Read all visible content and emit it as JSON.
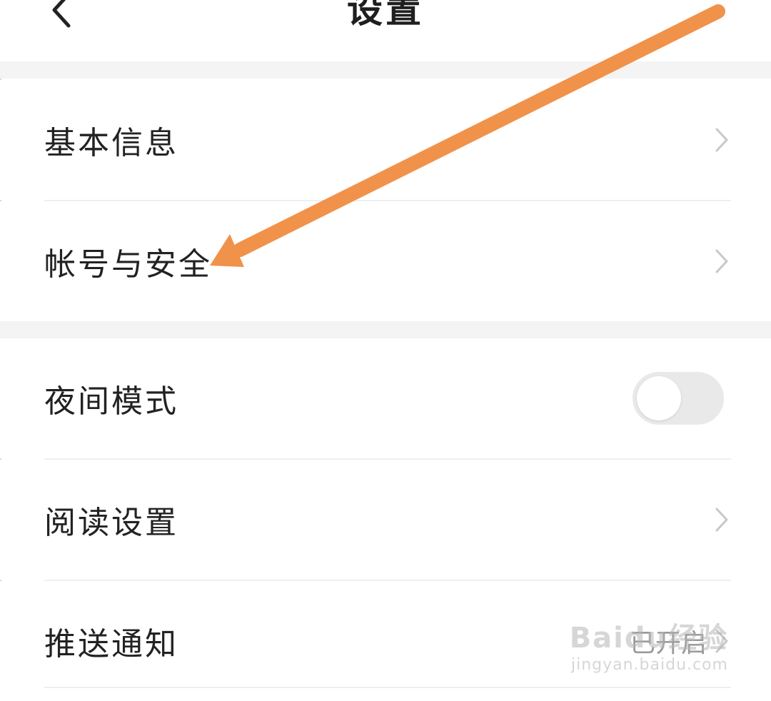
{
  "header": {
    "title": "设置",
    "back_icon": "chevron-left-icon"
  },
  "settings": {
    "basic_info": {
      "label": "基本信息",
      "icon": "chevron-right-icon"
    },
    "account_security": {
      "label": "帐号与安全",
      "icon": "chevron-right-icon"
    },
    "night_mode": {
      "label": "夜间模式",
      "enabled": false
    },
    "reading_settings": {
      "label": "阅读设置",
      "icon": "chevron-right-icon"
    },
    "push_notifications": {
      "label": "推送通知",
      "value": "已开启"
    }
  },
  "annotation": {
    "arrow_color": "#F0924A",
    "target": "account_security"
  },
  "watermark": {
    "brand": "Baidu经验",
    "url": "jingyan.baidu.com"
  },
  "colors": {
    "background": "#FFFFFF",
    "section_gap": "#F4F4F4",
    "toggle_off": "#E9E9E9",
    "text_primary": "#222222",
    "chevron": "#C8C8C8"
  }
}
